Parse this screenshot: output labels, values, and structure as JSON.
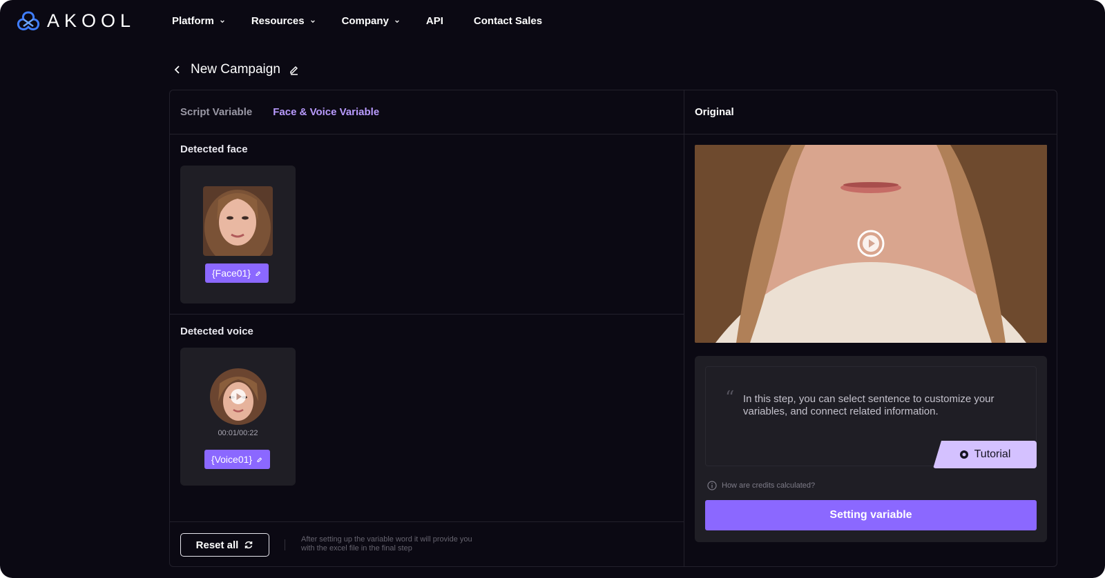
{
  "brand": {
    "name": "AKOOL",
    "accent": "#8b68ff",
    "accent_light": "#d4c1ff",
    "background": "#0b0913"
  },
  "nav": {
    "items": [
      {
        "label": "Platform",
        "has_dropdown": true
      },
      {
        "label": "Resources",
        "has_dropdown": true
      },
      {
        "label": "Company",
        "has_dropdown": true
      },
      {
        "label": "API",
        "has_dropdown": false
      },
      {
        "label": "Contact Sales",
        "has_dropdown": false
      }
    ]
  },
  "page": {
    "title": "New Campaign",
    "back_icon": "chevron-left-icon",
    "edit_icon": "pencil-icon"
  },
  "tabs": [
    {
      "label": "Script Variable",
      "active": false
    },
    {
      "label": "Face & Voice Variable",
      "active": true
    }
  ],
  "face_section": {
    "label": "Detected face",
    "chip": "{Face01}"
  },
  "voice_section": {
    "label": "Detected voice",
    "time": "00:01/00:22",
    "chip": "{Voice01}"
  },
  "footer": {
    "reset_label": "Reset all",
    "hint": "After setting up the variable word it will provide you with the excel file in the final step"
  },
  "preview": {
    "header": "Original",
    "tutorial_text": "In this step, you can select sentence to customize your variables, and connect related information.",
    "tutorial_button": "Tutorial",
    "credits_link": "How are credits calculated?",
    "setting_button": "Setting variable"
  }
}
